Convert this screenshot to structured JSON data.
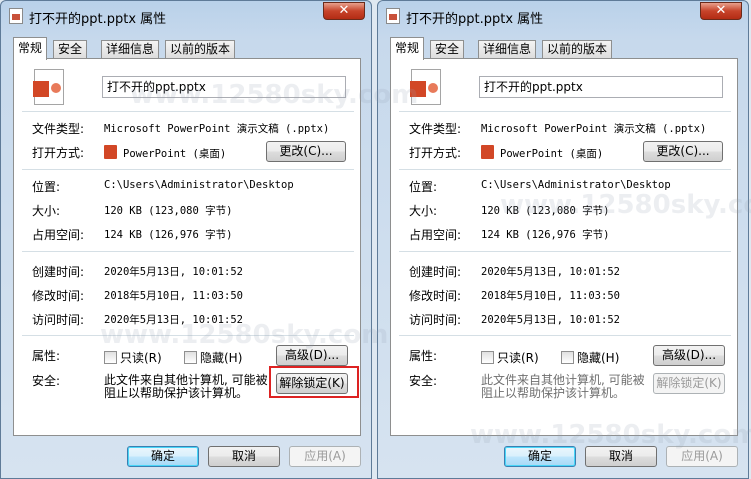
{
  "windows": [
    {
      "title": "打不开的ppt.pptx 属性",
      "close": "✕",
      "tabs": [
        "常规",
        "安全",
        "详细信息",
        "以前的版本"
      ],
      "filename": "打不开的ppt.pptx",
      "file_type_label": "文件类型:",
      "file_type_value": "Microsoft PowerPoint 演示文稿 (.pptx)",
      "open_with_label": "打开方式:",
      "open_with_value": "PowerPoint (桌面)",
      "change_button": "更改(C)...",
      "location_label": "位置:",
      "location_value": "C:\\Users\\Administrator\\Desktop",
      "size_label": "大小:",
      "size_value": "120 KB (123,080 字节)",
      "size_on_disk_label": "占用空间:",
      "size_on_disk_value": "124 KB (126,976 字节)",
      "created_label": "创建时间:",
      "created_value": "2020年5月13日, 10:01:52",
      "modified_label": "修改时间:",
      "modified_value": "2018年5月10日, 11:03:50",
      "accessed_label": "访问时间:",
      "accessed_value": "2020年5月13日, 10:01:52",
      "attributes_label": "属性:",
      "readonly_label": "只读(R)",
      "hidden_label": "隐藏(H)",
      "advanced_button": "高级(D)...",
      "security_label": "安全:",
      "security_text": "此文件来自其他计算机, 可能被阻止以帮助保护该计算机。",
      "unblock_button": "解除锁定(K)",
      "ok_button": "确定",
      "cancel_button": "取消",
      "apply_button": "应用(A)"
    }
  ],
  "watermark": "www.12580sky.com"
}
